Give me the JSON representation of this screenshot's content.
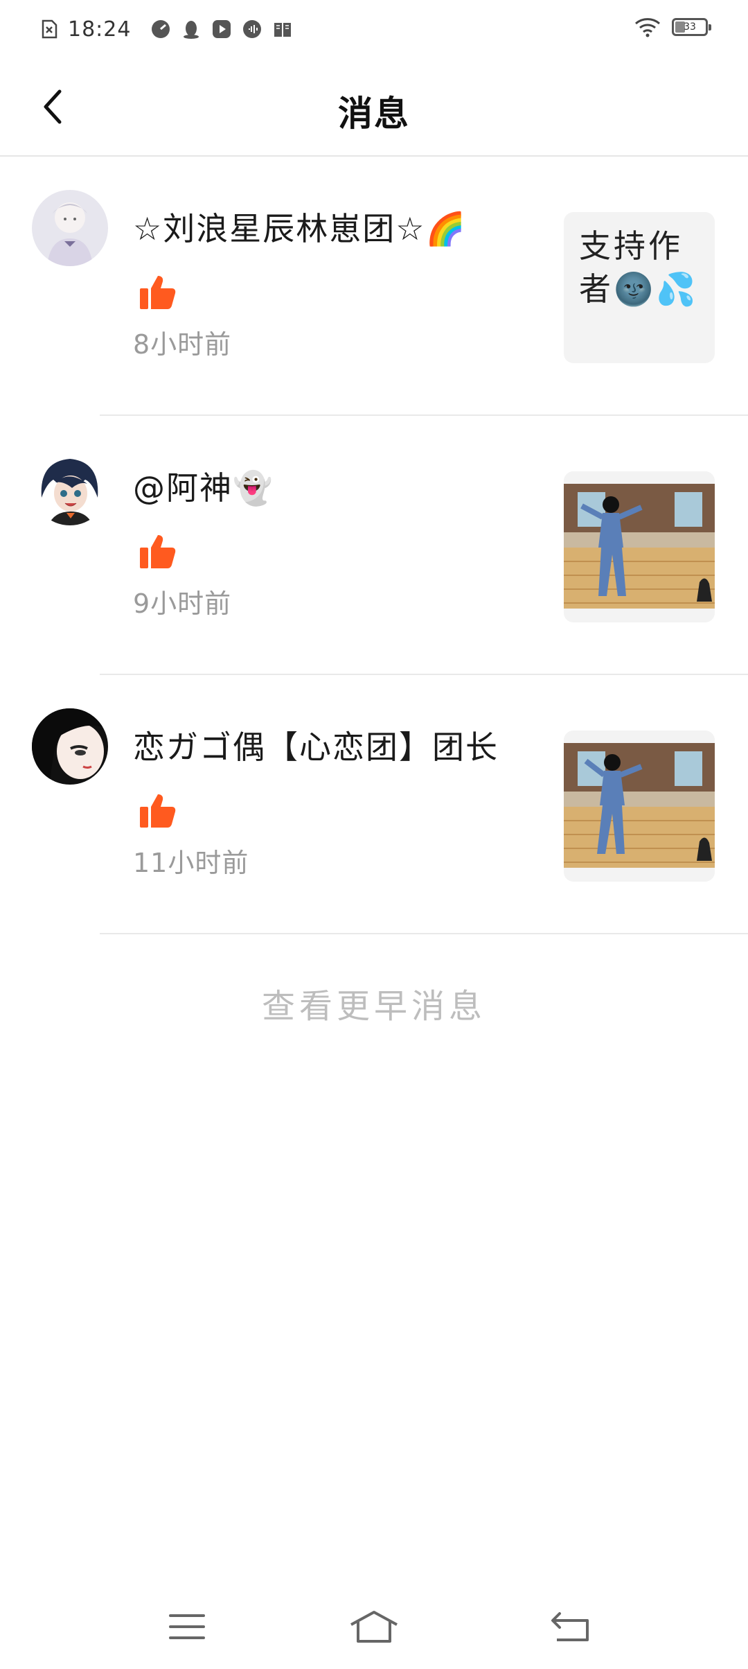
{
  "status_bar": {
    "time": "18:24",
    "battery": "33",
    "icons": [
      "sim-x-icon",
      "speed-icon",
      "qq-penguin-icon",
      "play-icon",
      "podcast-icon",
      "book-icon",
      "wifi-icon",
      "battery-icon"
    ]
  },
  "header": {
    "title": "消息",
    "back_icon": "chevron-left-icon"
  },
  "messages": [
    {
      "name": "☆刘浪星辰林崽团☆🌈",
      "time": "8小时前",
      "reaction": "thumbs-up-icon",
      "thumb_text": "支持作者🌚💦",
      "thumb_type": "text"
    },
    {
      "name": "@阿神👻",
      "time": "9小时前",
      "reaction": "thumbs-up-icon",
      "thumb_type": "image"
    },
    {
      "name": "恋ガゴ偶【心恋团】团长",
      "time": "11小时前",
      "reaction": "thumbs-up-icon",
      "thumb_type": "image"
    }
  ],
  "more_link": "查看更早消息",
  "nav_bar": {
    "icons": [
      "menu-icon",
      "home-icon",
      "back-arrow-icon"
    ]
  },
  "colors": {
    "accent": "#ff5a1f",
    "muted": "#9a9a9a",
    "divider": "#e9e9e9"
  }
}
